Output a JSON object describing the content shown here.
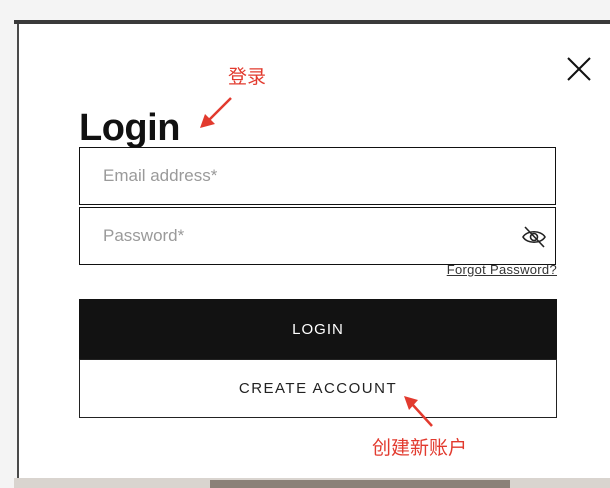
{
  "modal": {
    "title": "Login",
    "close_icon": "close-icon"
  },
  "form": {
    "email_placeholder": "Email address*",
    "email_value": "",
    "password_placeholder": "Password*",
    "password_value": "",
    "password_toggle_icon": "eye-off-icon",
    "forgot_password_label": "Forgot Password?",
    "login_button_label": "LOGIN",
    "create_account_label": "CREATE ACCOUNT"
  },
  "annotations": {
    "login_note": "登录",
    "create_account_note": "创建新账户",
    "color": "#e23a2e"
  },
  "colors": {
    "primary_button": "#121212",
    "text": "#111111"
  }
}
